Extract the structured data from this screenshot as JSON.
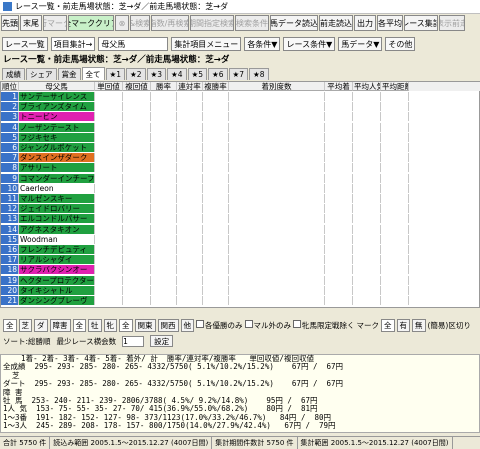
{
  "window": {
    "title": "レース一覧・前走馬場状態：芝→ダ／前走馬場状態：芝→ダ"
  },
  "toolbar": [
    "先頭",
    "末尾",
    "行マーク",
    "全マーククリア",
    "⊗",
    "&検索",
    "指数/再検索",
    "期間指定検索",
    "検索条件",
    "馬データ読込",
    "前走読込",
    "出力",
    "各平均",
    "レース集計",
    "表示前走"
  ],
  "path": {
    "label": "レース一覧",
    "item": "項目集計→",
    "field": "母父馬",
    "menu": "集計項目メニュー",
    "race_cond": "各条件▼",
    "race_cond2": "レース条件▼",
    "horse_data": "馬データ▼",
    "other": "その他"
  },
  "condition": "レース一覧・前走馬場状態：芝→ダ／前走馬場状態：芝→ダ",
  "tabs": [
    "成績",
    "シェア",
    "賞金",
    "全て",
    "★1",
    "★2",
    "★3",
    "★4",
    "★5",
    "★6",
    "★7",
    "★8"
  ],
  "table": {
    "headers": [
      "順位",
      "母父馬",
      "単回値",
      "複回値",
      "勝率",
      "連対率",
      "複勝率",
      "着別度数",
      "平均着",
      "平均人気",
      "平均距離"
    ],
    "rows": [
      [
        "1",
        "サンデーサイレンス",
        "",
        "",
        "",
        "",
        "",
        "",
        "",
        "",
        ""
      ],
      [
        "2",
        "ブライアンズタイム",
        "",
        "",
        "",
        "",
        "",
        "",
        "",
        "",
        ""
      ],
      [
        "3",
        "トニービン",
        "",
        "",
        "",
        "",
        "",
        "",
        "",
        "",
        ""
      ],
      [
        "4",
        "ノーザンテースト",
        "",
        "",
        "",
        "",
        "",
        "",
        "",
        "",
        ""
      ],
      [
        "5",
        "フジキセキ",
        "",
        "",
        "",
        "",
        "",
        "",
        "",
        "",
        ""
      ],
      [
        "6",
        "ジャングルポケット",
        "",
        "",
        "",
        "",
        "",
        "",
        "",
        "",
        ""
      ],
      [
        "7",
        "ダンスインザダーク",
        "",
        "",
        "",
        "",
        "",
        "",
        "",
        "",
        ""
      ],
      [
        "8",
        "アサリート",
        "",
        "",
        "",
        "",
        "",
        "",
        "",
        "",
        ""
      ],
      [
        "9",
        "コマンダーインチーフ",
        "",
        "",
        "",
        "",
        "",
        "",
        "",
        "",
        ""
      ],
      [
        "10",
        "Caerleon",
        "",
        "",
        "",
        "",
        "",
        "",
        "",
        "",
        ""
      ],
      [
        "11",
        "マルゼンスキー",
        "",
        "",
        "",
        "",
        "",
        "",
        "",
        "",
        ""
      ],
      [
        "12",
        "ジェイドロバリー",
        "",
        "",
        "",
        "",
        "",
        "",
        "",
        "",
        ""
      ],
      [
        "13",
        "エルコンドルパサー",
        "",
        "",
        "",
        "",
        "",
        "",
        "",
        "",
        ""
      ],
      [
        "14",
        "アグネスタキオン",
        "",
        "",
        "",
        "",
        "",
        "",
        "",
        "",
        ""
      ],
      [
        "15",
        "Woodman",
        "",
        "",
        "",
        "",
        "",
        "",
        "",
        "",
        ""
      ],
      [
        "16",
        "フレンチデピュティ",
        "",
        "",
        "",
        "",
        "",
        "",
        "",
        "",
        ""
      ],
      [
        "17",
        "リアルシャダイ",
        "",
        "",
        "",
        "",
        "",
        "",
        "",
        "",
        ""
      ],
      [
        "18",
        "サクラバクシンオー",
        "",
        "",
        "",
        "",
        "",
        "",
        "",
        "",
        ""
      ],
      [
        "19",
        "ヘクタープロテクター",
        "",
        "",
        "",
        "",
        "",
        "",
        "",
        "",
        ""
      ],
      [
        "20",
        "タイキシャトル",
        "",
        "",
        "",
        "",
        "",
        "",
        "",
        "",
        ""
      ],
      [
        "21",
        "ダンシングブレーヴ",
        "",
        "",
        "",
        "",
        "",
        "",
        "",
        "",
        ""
      ]
    ],
    "name_colors": [
      "#20a040",
      "#20a040",
      "#e020b0",
      "#20a040",
      "#20a040",
      "#20a040",
      "#e07020",
      "#20a040",
      "#20a040",
      "#ffffff",
      "#20a040",
      "#20a040",
      "#20a040",
      "#20a040",
      "#ffffff",
      "#20a040",
      "#20a040",
      "#e020b0",
      "#20a040",
      "#20a040",
      "#20a040"
    ]
  },
  "options": {
    "all": "全",
    "turf": "芝",
    "dirt": "ダ",
    "hurdle": "障害",
    "all2": "全",
    "mare": "牡",
    "female": "牝",
    "all3": "全",
    "kanto": "関東",
    "kansai": "関西",
    "other": "他",
    "check1": "各優勝のみ",
    "check2": "マル外のみ",
    "check3": "牝馬限定戦除く",
    "mark": "マーク",
    "all4": "全",
    "yes": "有",
    "no": "無",
    "easy": "(簡易)区切り"
  },
  "sort": {
    "label": "ソート:総勝順",
    "min_label": "最少レース横会数",
    "min_value": "1",
    "set": "設定"
  },
  "summary": {
    "header": "    1着- 2着- 3着- 4着- 5着- 着外/ 計  勝率/連対率/複勝率   単回収値/複回収値",
    "lines": [
      "全成績  295- 293- 285- 280- 265- 4332/5750( 5.1%/10.2%/15.2%)    67円 /  67円",
      "  芝",
      "ダート  295- 293- 285- 280- 265- 4332/5750( 5.1%/10.2%/15.2%)    67円 /  67円",
      "障 害",
      "牡 馬  253- 240- 211- 239- 2806/3788( 4.5%/ 9.2%/14.8%)    95円 /  67円",
      "1人 気  153- 75- 55- 35- 27- 70/ 415(36.9%/55.0%/68.2%)    80円 /  81円",
      "1～3番  191- 182- 152- 127- 98- 373/1123(17.0%/33.2%/46.7%)   84円 /  80円",
      "1～3人  245- 289- 208- 178- 157- 800/1750(14.0%/27.9%/42.4%)   67円 /  79円"
    ]
  },
  "status": {
    "total": "合計 5750 件",
    "range": "読込み範囲 2005.1.5～2015.12.27 (4007日間)",
    "count": "集計期間件数計 5750 件",
    "range2": "集計範囲 2005.1.5～2015.12.27 (4007日間)"
  }
}
